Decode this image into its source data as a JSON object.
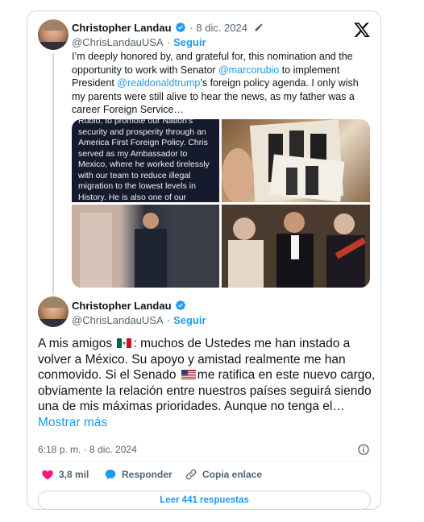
{
  "quoted_tweet": {
    "author_name": "Christopher Landau",
    "date": "8 dic. 2024",
    "handle": "@ChrisLandauUSA",
    "follow_label": "Seguir",
    "text_parts": [
      "I’m deeply honored by, and grateful for, this nomination and the opportunity to work with Senator ",
      "@marcorubio",
      " to implement President ",
      "@realdonaldtrump",
      "’s foreign policy agenda. I only wish my parents were still alive to hear the news, as my father was a career Foreign Service…"
    ],
    "image_1_text": "Rubio, to promote our Nation's security and prosperity through an America First Foreign Policy. Chris served as my Ambassador to Mexico, where he worked tirelessly with our team to reduce illegal migration to the lowest levels in History. He is also one of our"
  },
  "main_tweet": {
    "author_name": "Christopher Landau",
    "handle": "@ChrisLandauUSA",
    "follow_label": "Seguir",
    "text_1": "A mis amigos",
    "text_2": ": muchos de Ustedes me han instado a volver a México. Su apoyo y amistad realmente me han conmovido. Si el Senado",
    "text_3": "me ratifica en este nuevo cargo, obviamente la relación entre nuestros países seguirá siendo una de mis máximas prioridades. Aunque no tenga el…",
    "show_more": "Mostrar más",
    "timestamp": "6:18 p. m. · 8 dic. 2024"
  },
  "actions": {
    "likes": "3,8 mil",
    "reply": "Responder",
    "copy_link": "Copia enlace",
    "read_replies": "Leer 441 respuestas"
  },
  "colors": {
    "accent": "#1d9bf0",
    "heart": "#f91880",
    "text": "#0f1419",
    "muted": "#536471",
    "border": "#cfd9de"
  }
}
